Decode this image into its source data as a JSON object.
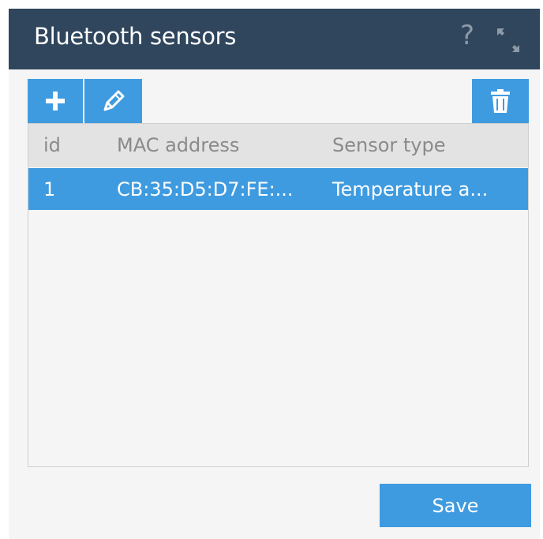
{
  "window": {
    "title": "Bluetooth sensors",
    "help_icon": "?"
  },
  "toolbar": {
    "add_icon": "plus-icon",
    "edit_icon": "pencil-icon",
    "delete_icon": "trash-icon"
  },
  "table": {
    "columns": [
      "id",
      "MAC address",
      "Sensor type"
    ],
    "rows": [
      {
        "id": "1",
        "mac": "CB:35:D5:D7:FE:...",
        "type": "Temperature a...",
        "selected": true
      }
    ]
  },
  "footer": {
    "save_label": "Save"
  },
  "colors": {
    "titlebar": "#2f465d",
    "accent": "#3f9be0",
    "header_bg": "#e3e3e3",
    "panel_bg": "#f5f5f5"
  }
}
